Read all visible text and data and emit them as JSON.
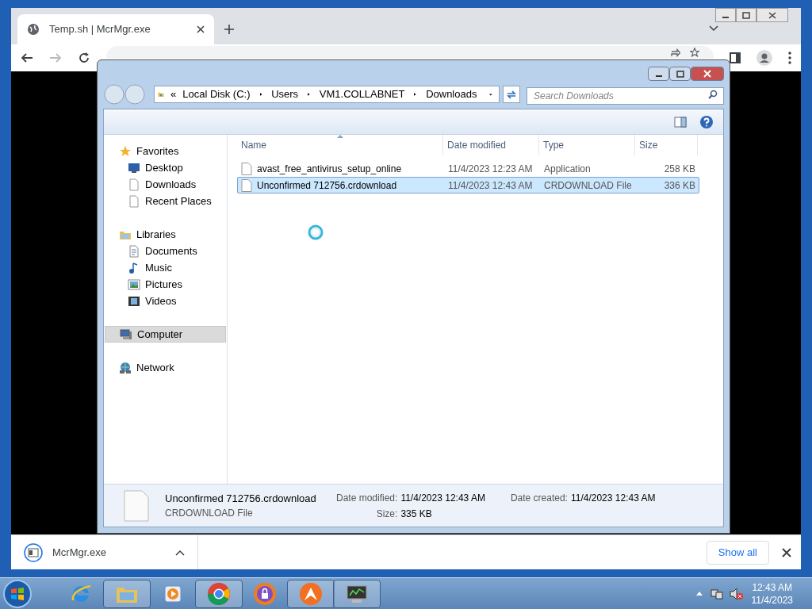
{
  "browser": {
    "tab": {
      "title": "Temp.sh | McrMgr.exe"
    },
    "download": {
      "file": "McrMgr.exe"
    },
    "show_all": "Show all"
  },
  "explorer": {
    "address": [
      "Local Disk (C:)",
      "Users",
      "VM1.COLLABNET",
      "Downloads"
    ],
    "address_prefix": "«",
    "search": {
      "placeholder": "Search Downloads"
    },
    "nav": [
      {
        "label": "Favorites",
        "kind": "star",
        "selected": false,
        "children": [
          {
            "label": "Desktop",
            "kind": "desktop",
            "selected": false
          },
          {
            "label": "Downloads",
            "kind": "page",
            "selected": false
          },
          {
            "label": "Recent Places",
            "kind": "page",
            "selected": false
          }
        ]
      },
      {
        "label": "Libraries",
        "kind": "folder",
        "selected": false,
        "children": [
          {
            "label": "Documents",
            "kind": "doc",
            "selected": false
          },
          {
            "label": "Music",
            "kind": "music",
            "selected": false
          },
          {
            "label": "Pictures",
            "kind": "picture",
            "selected": false
          },
          {
            "label": "Videos",
            "kind": "video",
            "selected": false
          }
        ]
      },
      {
        "label": "Computer",
        "kind": "computer",
        "selected": true
      },
      {
        "label": "Network",
        "kind": "network",
        "selected": false
      }
    ],
    "columns": [
      "Name",
      "Date modified",
      "Type",
      "Size"
    ],
    "rows": [
      {
        "name": "avast_free_antivirus_setup_online",
        "date": "11/4/2023 12:23 AM",
        "type": "Application",
        "size": "258 KB",
        "selected": false
      },
      {
        "name": "Unconfirmed 712756.crdownload",
        "date": "11/4/2023 12:43 AM",
        "type": "CRDOWNLOAD File",
        "size": "336 KB",
        "selected": true
      }
    ],
    "details": {
      "name": "Unconfirmed 712756.crdownload",
      "type": "CRDOWNLOAD File",
      "fields": [
        {
          "label": "Date modified:",
          "value": "11/4/2023 12:43 AM"
        },
        {
          "label": "Date created:",
          "value": "11/4/2023 12:43 AM"
        },
        {
          "label": "Size:",
          "value": "335 KB"
        }
      ]
    }
  },
  "taskbar": {
    "apps": [
      {
        "kind": "ie",
        "running": false
      },
      {
        "kind": "explorer",
        "running": true
      },
      {
        "kind": "media",
        "running": false
      },
      {
        "kind": "chrome",
        "running": true
      },
      {
        "kind": "lock",
        "running": false
      },
      {
        "kind": "avast",
        "running": true
      },
      {
        "kind": "monitor",
        "running": true
      }
    ],
    "time": "12:43 AM",
    "date": "11/4/2023"
  }
}
